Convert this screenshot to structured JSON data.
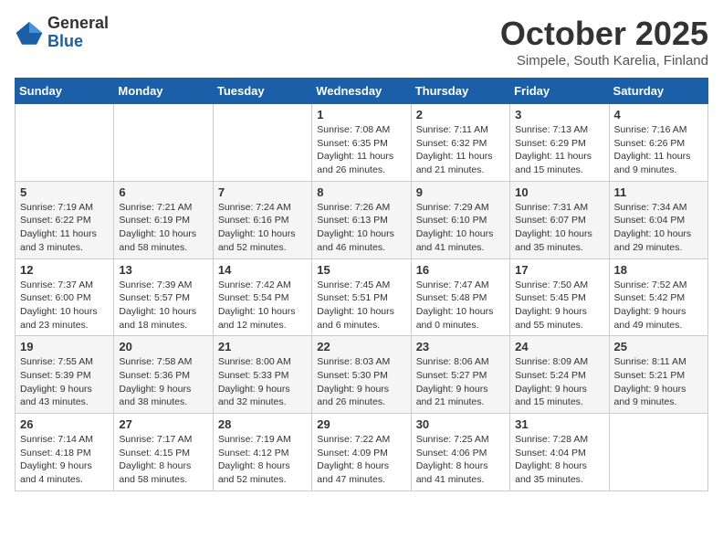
{
  "logo": {
    "general": "General",
    "blue": "Blue"
  },
  "title": "October 2025",
  "subtitle": "Simpele, South Karelia, Finland",
  "days_of_week": [
    "Sunday",
    "Monday",
    "Tuesday",
    "Wednesday",
    "Thursday",
    "Friday",
    "Saturday"
  ],
  "weeks": [
    [
      {
        "day": "",
        "detail": ""
      },
      {
        "day": "",
        "detail": ""
      },
      {
        "day": "",
        "detail": ""
      },
      {
        "day": "1",
        "detail": "Sunrise: 7:08 AM\nSunset: 6:35 PM\nDaylight: 11 hours and 26 minutes."
      },
      {
        "day": "2",
        "detail": "Sunrise: 7:11 AM\nSunset: 6:32 PM\nDaylight: 11 hours and 21 minutes."
      },
      {
        "day": "3",
        "detail": "Sunrise: 7:13 AM\nSunset: 6:29 PM\nDaylight: 11 hours and 15 minutes."
      },
      {
        "day": "4",
        "detail": "Sunrise: 7:16 AM\nSunset: 6:26 PM\nDaylight: 11 hours and 9 minutes."
      }
    ],
    [
      {
        "day": "5",
        "detail": "Sunrise: 7:19 AM\nSunset: 6:22 PM\nDaylight: 11 hours and 3 minutes."
      },
      {
        "day": "6",
        "detail": "Sunrise: 7:21 AM\nSunset: 6:19 PM\nDaylight: 10 hours and 58 minutes."
      },
      {
        "day": "7",
        "detail": "Sunrise: 7:24 AM\nSunset: 6:16 PM\nDaylight: 10 hours and 52 minutes."
      },
      {
        "day": "8",
        "detail": "Sunrise: 7:26 AM\nSunset: 6:13 PM\nDaylight: 10 hours and 46 minutes."
      },
      {
        "day": "9",
        "detail": "Sunrise: 7:29 AM\nSunset: 6:10 PM\nDaylight: 10 hours and 41 minutes."
      },
      {
        "day": "10",
        "detail": "Sunrise: 7:31 AM\nSunset: 6:07 PM\nDaylight: 10 hours and 35 minutes."
      },
      {
        "day": "11",
        "detail": "Sunrise: 7:34 AM\nSunset: 6:04 PM\nDaylight: 10 hours and 29 minutes."
      }
    ],
    [
      {
        "day": "12",
        "detail": "Sunrise: 7:37 AM\nSunset: 6:00 PM\nDaylight: 10 hours and 23 minutes."
      },
      {
        "day": "13",
        "detail": "Sunrise: 7:39 AM\nSunset: 5:57 PM\nDaylight: 10 hours and 18 minutes."
      },
      {
        "day": "14",
        "detail": "Sunrise: 7:42 AM\nSunset: 5:54 PM\nDaylight: 10 hours and 12 minutes."
      },
      {
        "day": "15",
        "detail": "Sunrise: 7:45 AM\nSunset: 5:51 PM\nDaylight: 10 hours and 6 minutes."
      },
      {
        "day": "16",
        "detail": "Sunrise: 7:47 AM\nSunset: 5:48 PM\nDaylight: 10 hours and 0 minutes."
      },
      {
        "day": "17",
        "detail": "Sunrise: 7:50 AM\nSunset: 5:45 PM\nDaylight: 9 hours and 55 minutes."
      },
      {
        "day": "18",
        "detail": "Sunrise: 7:52 AM\nSunset: 5:42 PM\nDaylight: 9 hours and 49 minutes."
      }
    ],
    [
      {
        "day": "19",
        "detail": "Sunrise: 7:55 AM\nSunset: 5:39 PM\nDaylight: 9 hours and 43 minutes."
      },
      {
        "day": "20",
        "detail": "Sunrise: 7:58 AM\nSunset: 5:36 PM\nDaylight: 9 hours and 38 minutes."
      },
      {
        "day": "21",
        "detail": "Sunrise: 8:00 AM\nSunset: 5:33 PM\nDaylight: 9 hours and 32 minutes."
      },
      {
        "day": "22",
        "detail": "Sunrise: 8:03 AM\nSunset: 5:30 PM\nDaylight: 9 hours and 26 minutes."
      },
      {
        "day": "23",
        "detail": "Sunrise: 8:06 AM\nSunset: 5:27 PM\nDaylight: 9 hours and 21 minutes."
      },
      {
        "day": "24",
        "detail": "Sunrise: 8:09 AM\nSunset: 5:24 PM\nDaylight: 9 hours and 15 minutes."
      },
      {
        "day": "25",
        "detail": "Sunrise: 8:11 AM\nSunset: 5:21 PM\nDaylight: 9 hours and 9 minutes."
      }
    ],
    [
      {
        "day": "26",
        "detail": "Sunrise: 7:14 AM\nSunset: 4:18 PM\nDaylight: 9 hours and 4 minutes."
      },
      {
        "day": "27",
        "detail": "Sunrise: 7:17 AM\nSunset: 4:15 PM\nDaylight: 8 hours and 58 minutes."
      },
      {
        "day": "28",
        "detail": "Sunrise: 7:19 AM\nSunset: 4:12 PM\nDaylight: 8 hours and 52 minutes."
      },
      {
        "day": "29",
        "detail": "Sunrise: 7:22 AM\nSunset: 4:09 PM\nDaylight: 8 hours and 47 minutes."
      },
      {
        "day": "30",
        "detail": "Sunrise: 7:25 AM\nSunset: 4:06 PM\nDaylight: 8 hours and 41 minutes."
      },
      {
        "day": "31",
        "detail": "Sunrise: 7:28 AM\nSunset: 4:04 PM\nDaylight: 8 hours and 35 minutes."
      },
      {
        "day": "",
        "detail": ""
      }
    ]
  ]
}
